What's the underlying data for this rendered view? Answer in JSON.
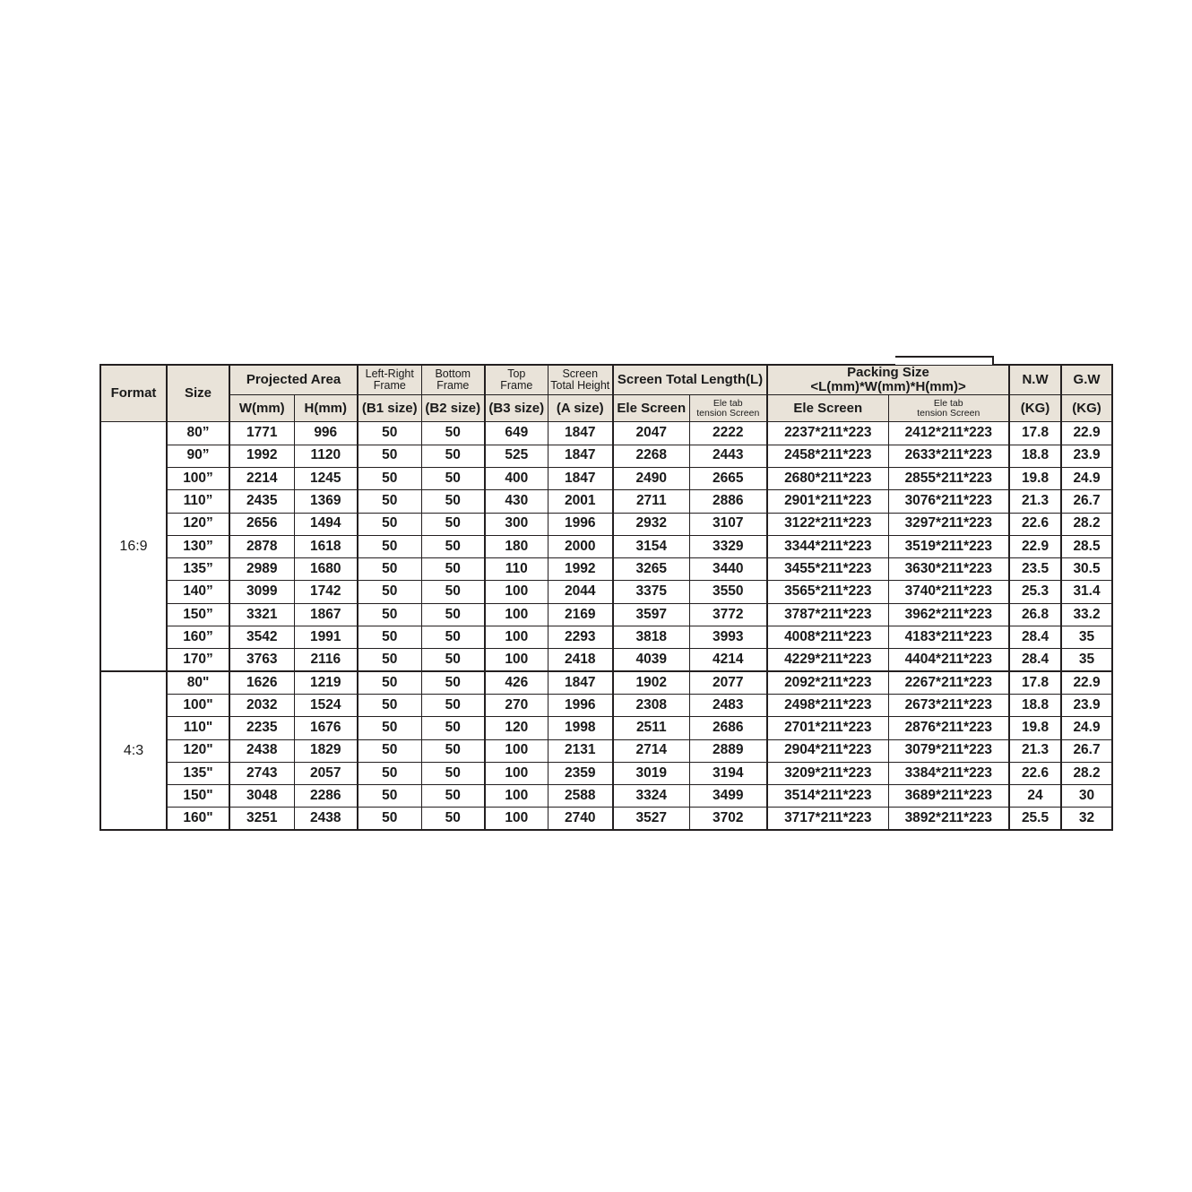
{
  "table": {
    "headers": {
      "format": "Format",
      "size": "Size",
      "projected_area": "Projected Area",
      "projected_w": "W(mm)",
      "projected_h": "H(mm)",
      "left_right_frame": "Left-Right\nFrame",
      "left_right_frame_l1": "Left-Right",
      "left_right_frame_l2": "Frame",
      "b1_size": "(B1 size)",
      "bottom_frame_l1": "Bottom",
      "bottom_frame_l2": "Frame",
      "b2_size": "(B2 size)",
      "top_frame_l1": "Top",
      "top_frame_l2": "Frame",
      "b3_size": "(B3 size)",
      "screen_total_height_l1": "Screen",
      "screen_total_height_l2": "Total Height",
      "a_size": "(A  size)",
      "screen_total_length": "Screen Total Length(L)",
      "stl_ele_screen": "Ele Screen",
      "stl_ele_tab_l1": "Ele tab",
      "stl_ele_tab_l2": "tension Screen",
      "packing_size": "Packing Size <L(mm)*W(mm)*H(mm)>",
      "ps_ele_screen": "Ele Screen",
      "ps_ele_tab_l1": "Ele tab",
      "ps_ele_tab_l2": "tension Screen",
      "nw": "N.W",
      "nw_unit": "(KG)",
      "gw": "G.W",
      "gw_unit": "(KG)"
    },
    "groups": [
      {
        "format": "16:9",
        "rows": [
          {
            "size": "80”",
            "w": "1771",
            "h": "996",
            "b1": "50",
            "b2": "50",
            "b3": "649",
            "a": "1847",
            "stl_ele": "2047",
            "stl_tab": "2222",
            "ps_ele": "2237*211*223",
            "ps_tab": "2412*211*223",
            "nw": "17.8",
            "gw": "22.9"
          },
          {
            "size": "90”",
            "w": "1992",
            "h": "1120",
            "b1": "50",
            "b2": "50",
            "b3": "525",
            "a": "1847",
            "stl_ele": "2268",
            "stl_tab": "2443",
            "ps_ele": "2458*211*223",
            "ps_tab": "2633*211*223",
            "nw": "18.8",
            "gw": "23.9"
          },
          {
            "size": "100”",
            "w": "2214",
            "h": "1245",
            "b1": "50",
            "b2": "50",
            "b3": "400",
            "a": "1847",
            "stl_ele": "2490",
            "stl_tab": "2665",
            "ps_ele": "2680*211*223",
            "ps_tab": "2855*211*223",
            "nw": "19.8",
            "gw": "24.9"
          },
          {
            "size": "110”",
            "w": "2435",
            "h": "1369",
            "b1": "50",
            "b2": "50",
            "b3": "430",
            "a": "2001",
            "stl_ele": "2711",
            "stl_tab": "2886",
            "ps_ele": "2901*211*223",
            "ps_tab": "3076*211*223",
            "nw": "21.3",
            "gw": "26.7"
          },
          {
            "size": "120”",
            "w": "2656",
            "h": "1494",
            "b1": "50",
            "b2": "50",
            "b3": "300",
            "a": "1996",
            "stl_ele": "2932",
            "stl_tab": "3107",
            "ps_ele": "3122*211*223",
            "ps_tab": "3297*211*223",
            "nw": "22.6",
            "gw": "28.2"
          },
          {
            "size": "130”",
            "w": "2878",
            "h": "1618",
            "b1": "50",
            "b2": "50",
            "b3": "180",
            "a": "2000",
            "stl_ele": "3154",
            "stl_tab": "3329",
            "ps_ele": "3344*211*223",
            "ps_tab": "3519*211*223",
            "nw": "22.9",
            "gw": "28.5"
          },
          {
            "size": "135”",
            "w": "2989",
            "h": "1680",
            "b1": "50",
            "b2": "50",
            "b3": "110",
            "a": "1992",
            "stl_ele": "3265",
            "stl_tab": "3440",
            "ps_ele": "3455*211*223",
            "ps_tab": "3630*211*223",
            "nw": "23.5",
            "gw": "30.5"
          },
          {
            "size": "140”",
            "w": "3099",
            "h": "1742",
            "b1": "50",
            "b2": "50",
            "b3": "100",
            "a": "2044",
            "stl_ele": "3375",
            "stl_tab": "3550",
            "ps_ele": "3565*211*223",
            "ps_tab": "3740*211*223",
            "nw": "25.3",
            "gw": "31.4"
          },
          {
            "size": "150”",
            "w": "3321",
            "h": "1867",
            "b1": "50",
            "b2": "50",
            "b3": "100",
            "a": "2169",
            "stl_ele": "3597",
            "stl_tab": "3772",
            "ps_ele": "3787*211*223",
            "ps_tab": "3962*211*223",
            "nw": "26.8",
            "gw": "33.2"
          },
          {
            "size": "160”",
            "w": "3542",
            "h": "1991",
            "b1": "50",
            "b2": "50",
            "b3": "100",
            "a": "2293",
            "stl_ele": "3818",
            "stl_tab": "3993",
            "ps_ele": "4008*211*223",
            "ps_tab": "4183*211*223",
            "nw": "28.4",
            "gw": "35"
          },
          {
            "size": "170”",
            "w": "3763",
            "h": "2116",
            "b1": "50",
            "b2": "50",
            "b3": "100",
            "a": "2418",
            "stl_ele": "4039",
            "stl_tab": "4214",
            "ps_ele": "4229*211*223",
            "ps_tab": "4404*211*223",
            "nw": "28.4",
            "gw": "35"
          }
        ]
      },
      {
        "format": "4:3",
        "rows": [
          {
            "size": "80\"",
            "w": "1626",
            "h": "1219",
            "b1": "50",
            "b2": "50",
            "b3": "426",
            "a": "1847",
            "stl_ele": "1902",
            "stl_tab": "2077",
            "ps_ele": "2092*211*223",
            "ps_tab": "2267*211*223",
            "nw": "17.8",
            "gw": "22.9"
          },
          {
            "size": "100\"",
            "w": "2032",
            "h": "1524",
            "b1": "50",
            "b2": "50",
            "b3": "270",
            "a": "1996",
            "stl_ele": "2308",
            "stl_tab": "2483",
            "ps_ele": "2498*211*223",
            "ps_tab": "2673*211*223",
            "nw": "18.8",
            "gw": "23.9"
          },
          {
            "size": "110\"",
            "w": "2235",
            "h": "1676",
            "b1": "50",
            "b2": "50",
            "b3": "120",
            "a": "1998",
            "stl_ele": "2511",
            "stl_tab": "2686",
            "ps_ele": "2701*211*223",
            "ps_tab": "2876*211*223",
            "nw": "19.8",
            "gw": "24.9"
          },
          {
            "size": "120\"",
            "w": "2438",
            "h": "1829",
            "b1": "50",
            "b2": "50",
            "b3": "100",
            "a": "2131",
            "stl_ele": "2714",
            "stl_tab": "2889",
            "ps_ele": "2904*211*223",
            "ps_tab": "3079*211*223",
            "nw": "21.3",
            "gw": "26.7"
          },
          {
            "size": "135\"",
            "w": "2743",
            "h": "2057",
            "b1": "50",
            "b2": "50",
            "b3": "100",
            "a": "2359",
            "stl_ele": "3019",
            "stl_tab": "3194",
            "ps_ele": "3209*211*223",
            "ps_tab": "3384*211*223",
            "nw": "22.6",
            "gw": "28.2"
          },
          {
            "size": "150\"",
            "w": "3048",
            "h": "2286",
            "b1": "50",
            "b2": "50",
            "b3": "100",
            "a": "2588",
            "stl_ele": "3324",
            "stl_tab": "3499",
            "ps_ele": "3514*211*223",
            "ps_tab": "3689*211*223",
            "nw": "24",
            "gw": "30"
          },
          {
            "size": "160\"",
            "w": "3251",
            "h": "2438",
            "b1": "50",
            "b2": "50",
            "b3": "100",
            "a": "2740",
            "stl_ele": "3527",
            "stl_tab": "3702",
            "ps_ele": "3717*211*223",
            "ps_tab": "3892*211*223",
            "nw": "25.5",
            "gw": "32"
          }
        ]
      }
    ],
    "colors": {
      "header_background": "#E9E3D9",
      "border": "#231F20",
      "text": "#1A1A1A",
      "body_background": "#FFFFFF"
    }
  }
}
